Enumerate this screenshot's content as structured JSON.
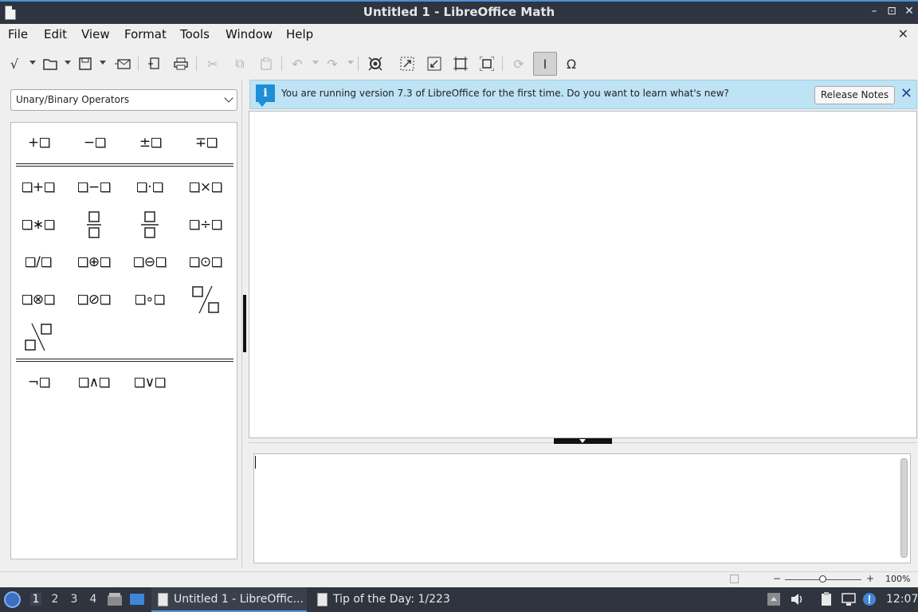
{
  "window": {
    "title": "Untitled 1 - LibreOffice Math"
  },
  "menu": {
    "items": [
      "File",
      "Edit",
      "View",
      "Format",
      "Tools",
      "Window",
      "Help"
    ]
  },
  "sidebar": {
    "category": "Unary/Binary Operators",
    "unary": [
      "+",
      "−",
      "±",
      "∓"
    ],
    "binary_ops": [
      "+",
      "−",
      "·",
      "×",
      "∗",
      "÷",
      "/",
      "⊕",
      "⊖",
      "⊙",
      "⊗",
      "⊘",
      "∘"
    ],
    "logic": [
      "¬",
      "∧",
      "∨"
    ]
  },
  "infobar": {
    "message": "You are running version 7.3 of LibreOffice for the first time. Do you want to learn what's new?",
    "button": "Release Notes"
  },
  "statusbar": {
    "zoom": "100%",
    "zoom_fraction": 0.5
  },
  "taskbar": {
    "workspaces": [
      "1",
      "2",
      "3",
      "4"
    ],
    "current_workspace": "1",
    "tasks": [
      "Untitled 1 - LibreOffic...",
      "Tip of the Day: 1/223"
    ],
    "clock": "12:07"
  }
}
